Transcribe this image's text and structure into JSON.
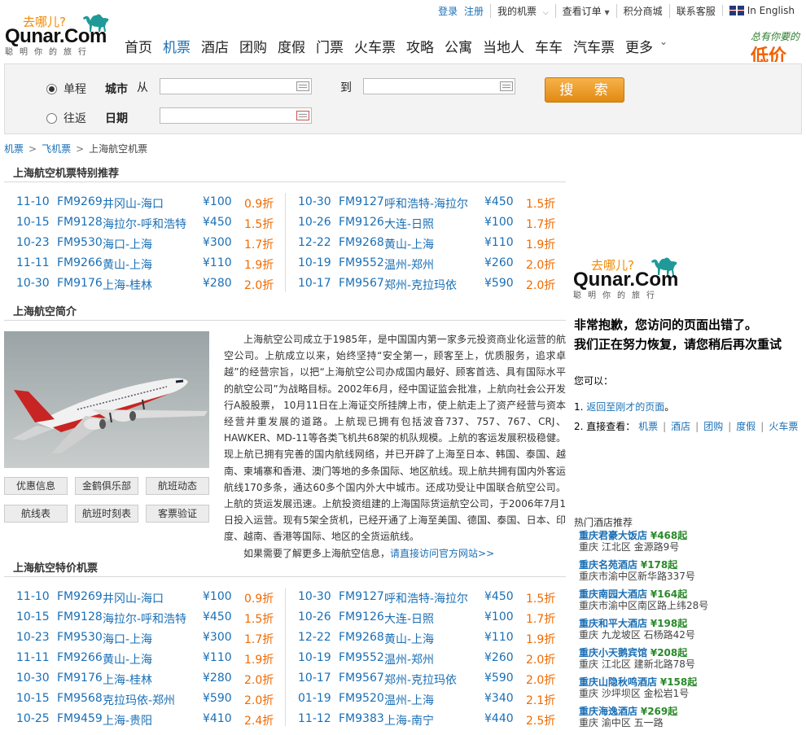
{
  "topnav": {
    "login": "登录",
    "register": "注册",
    "my_tickets": "我的机票",
    "orders": "查看订单",
    "points_mall": "积分商城",
    "support": "联系客服",
    "english": "In English"
  },
  "logo": {
    "brand": "Qunar.Com",
    "tagline": "去哪儿?",
    "slogan": "聪明你的旅行"
  },
  "mainnav": [
    "首页",
    "机票",
    "酒店",
    "团购",
    "度假",
    "门票",
    "火车票",
    "攻略",
    "公寓",
    "当地人",
    "车车",
    "汽车票",
    "更多"
  ],
  "mainnav_active": "机票",
  "ad": {
    "line1": "总有你要的",
    "line2": "低价"
  },
  "search": {
    "oneway": "单程",
    "roundtrip": "往返",
    "city_label": "城市",
    "from_label": "从",
    "to_label": "到",
    "date_label": "日期",
    "button": "搜 索",
    "from_value": "",
    "to_value": "",
    "date_value": ""
  },
  "breadcrumb": [
    "机票",
    "飞机票",
    "上海航空机票"
  ],
  "section1_title": "上海航空机票特别推荐",
  "section2_title": "上海航空简介",
  "section3_title": "上海航空特价机票",
  "special": {
    "left": [
      {
        "date": "11-10",
        "flight": "FM9269",
        "route": "井冈山-海口",
        "price": "¥100",
        "discount": "0.9折"
      },
      {
        "date": "10-15",
        "flight": "FM9128",
        "route": "海拉尔-呼和浩特",
        "price": "¥450",
        "discount": "1.5折"
      },
      {
        "date": "10-23",
        "flight": "FM9530",
        "route": "海口-上海",
        "price": "¥300",
        "discount": "1.7折"
      },
      {
        "date": "11-11",
        "flight": "FM9266",
        "route": "黄山-上海",
        "price": "¥110",
        "discount": "1.9折"
      },
      {
        "date": "10-30",
        "flight": "FM9176",
        "route": "上海-桂林",
        "price": "¥280",
        "discount": "2.0折"
      }
    ],
    "right": [
      {
        "date": "10-30",
        "flight": "FM9127",
        "route": "呼和浩特-海拉尔",
        "price": "¥450",
        "discount": "1.5折"
      },
      {
        "date": "10-26",
        "flight": "FM9126",
        "route": "大连-日照",
        "price": "¥100",
        "discount": "1.7折"
      },
      {
        "date": "12-22",
        "flight": "FM9268",
        "route": "黄山-上海",
        "price": "¥110",
        "discount": "1.9折"
      },
      {
        "date": "10-19",
        "flight": "FM9552",
        "route": "温州-郑州",
        "price": "¥260",
        "discount": "2.0折"
      },
      {
        "date": "10-17",
        "flight": "FM9567",
        "route": "郑州-克拉玛依",
        "price": "¥590",
        "discount": "2.0折"
      }
    ]
  },
  "cheap": {
    "left": [
      {
        "date": "11-10",
        "flight": "FM9269",
        "route": "井冈山-海口",
        "price": "¥100",
        "discount": "0.9折"
      },
      {
        "date": "10-15",
        "flight": "FM9128",
        "route": "海拉尔-呼和浩特",
        "price": "¥450",
        "discount": "1.5折"
      },
      {
        "date": "10-23",
        "flight": "FM9530",
        "route": "海口-上海",
        "price": "¥300",
        "discount": "1.7折"
      },
      {
        "date": "11-11",
        "flight": "FM9266",
        "route": "黄山-上海",
        "price": "¥110",
        "discount": "1.9折"
      },
      {
        "date": "10-30",
        "flight": "FM9176",
        "route": "上海-桂林",
        "price": "¥280",
        "discount": "2.0折"
      },
      {
        "date": "10-15",
        "flight": "FM9568",
        "route": "克拉玛依-郑州",
        "price": "¥590",
        "discount": "2.0折"
      },
      {
        "date": "10-25",
        "flight": "FM9459",
        "route": "上海-贵阳",
        "price": "¥410",
        "discount": "2.4折"
      }
    ],
    "right": [
      {
        "date": "10-30",
        "flight": "FM9127",
        "route": "呼和浩特-海拉尔",
        "price": "¥450",
        "discount": "1.5折"
      },
      {
        "date": "10-26",
        "flight": "FM9126",
        "route": "大连-日照",
        "price": "¥100",
        "discount": "1.7折"
      },
      {
        "date": "12-22",
        "flight": "FM9268",
        "route": "黄山-上海",
        "price": "¥110",
        "discount": "1.9折"
      },
      {
        "date": "10-19",
        "flight": "FM9552",
        "route": "温州-郑州",
        "price": "¥260",
        "discount": "2.0折"
      },
      {
        "date": "10-17",
        "flight": "FM9567",
        "route": "郑州-克拉玛依",
        "price": "¥590",
        "discount": "2.0折"
      },
      {
        "date": "01-19",
        "flight": "FM9520",
        "route": "温州-上海",
        "price": "¥340",
        "discount": "2.1折"
      },
      {
        "date": "11-12",
        "flight": "FM9383",
        "route": "上海-南宁",
        "price": "¥440",
        "discount": "2.5折"
      }
    ]
  },
  "intro": {
    "para1": "上海航空公司成立于1985年，是中国国内第一家多元投资商业化运营的航空公司。上航成立以来，始终坚持“安全第一，顾客至上，优质服务，追求卓越”的经营宗旨，以把“上海航空公司办成国内最好、顾客首选、具有国际水平的航空公司”为战略目标。2002年6月，经中国证监会批准，上航向社会公开发行A股股票， 10月11日在上海证交所挂牌上市，使上航走上了资产经营与资本经营并重发展的道路。上航现已拥有包括波音737、757、767、CRJ、HAWKER、MD-11等各类飞机共68架的机队规模。上航的客运发展积极稳健。现上航已拥有完善的国内航线网络，并已开辟了上海至日本、韩国、泰国、越南、柬埔寨和香港、澳门等地的多条国际、地区航线。现上航共拥有国内外客运航线170多条，通达60多个国内外大中城市。还成功受让中国联合航空公司。上航的货运发展迅速。上航投资组建的上海国际货运航空公司，于2006年7月1日投入运营。现有5架全货机，已经开通了上海至美国、德国、泰国、日本、印度、越南、香港等国际、地区的全货运航线。",
    "more_prefix": "如果需要了解更多上海航空信息，",
    "more_link": "请直接访问官方网站>>"
  },
  "tools": [
    "优惠信息",
    "金鹤俱乐部",
    "航班动态",
    "航线表",
    "航班时刻表",
    "客票验证"
  ],
  "error": {
    "line1": "非常抱歉，您访问的页面出错了。",
    "line2": "我们正在努力恢复，请您稍后再次重试",
    "you_can": "您可以：",
    "opt1_prefix": "1. ",
    "opt1_link": "返回至刚才的页面",
    "opt1_suffix": "。",
    "opt2_prefix": "2. 直接查看：",
    "opt2_links": [
      "机票",
      "酒店",
      "团购",
      "度假",
      "火车票"
    ]
  },
  "hot_hotels": {
    "title": "热门酒店推荐",
    "items": [
      {
        "name": "重庆君豪大饭店",
        "price": "¥468起",
        "addr": "重庆 江北区 金源路9号"
      },
      {
        "name": "重庆名苑酒店",
        "price": "¥178起",
        "addr": "重庆市渝中区新华路337号"
      },
      {
        "name": "重庆南园大酒店",
        "price": "¥164起",
        "addr": "重庆市渝中区南区路上纬28号"
      },
      {
        "name": "重庆和平大酒店",
        "price": "¥198起",
        "addr": "重庆 九龙坡区 石杨路42号"
      },
      {
        "name": "重庆小天鹅宾馆",
        "price": "¥208起",
        "addr": "重庆 江北区 建新北路78号"
      },
      {
        "name": "重庆山隐秋鸣酒店",
        "price": "¥158起",
        "addr": "重庆 沙坪坝区 金松岩1号"
      },
      {
        "name": "重庆海逸酒店",
        "price": "¥269起",
        "addr": "重庆 渝中区 五一路"
      }
    ]
  }
}
